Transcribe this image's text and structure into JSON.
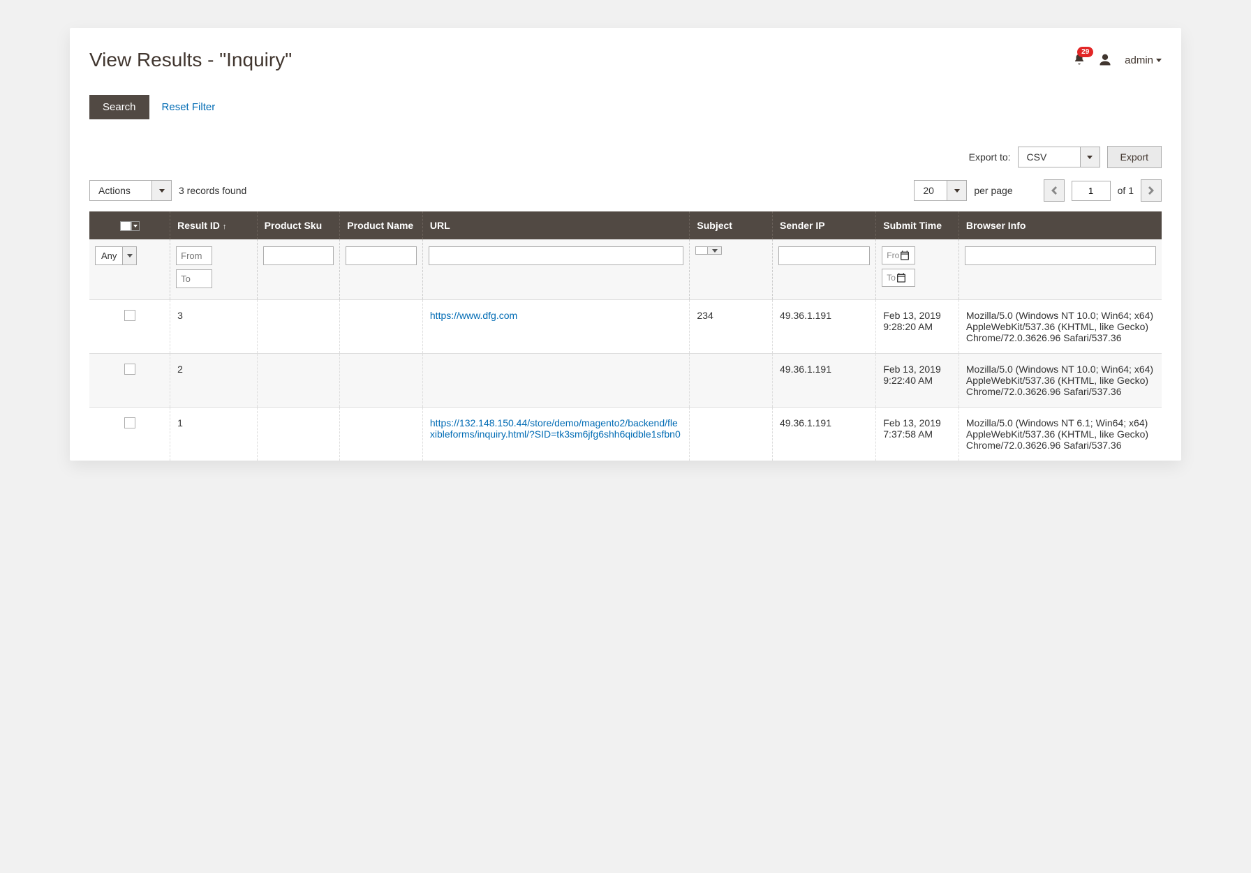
{
  "header": {
    "title": "View Results - \"Inquiry\"",
    "notification_count": "29",
    "admin_label": "admin"
  },
  "toolbar": {
    "search_label": "Search",
    "reset_filter_label": "Reset Filter"
  },
  "export": {
    "label": "Export to:",
    "format": "CSV",
    "button": "Export"
  },
  "actions": {
    "label": "Actions",
    "records_found": "3 records found"
  },
  "pager": {
    "page_size": "20",
    "per_page_label": "per page",
    "current": "1",
    "of_label": "of 1"
  },
  "columns": {
    "result_id": "Result ID",
    "product_sku": "Product Sku",
    "product_name": "Product Name",
    "url": "URL",
    "subject": "Subject",
    "sender_ip": "Sender IP",
    "submit_time": "Submit Time",
    "browser_info": "Browser Info"
  },
  "filters": {
    "any": "Any",
    "from_ph": "From",
    "to_ph": "To",
    "date_from_ph": "Fro",
    "date_to_ph": "To"
  },
  "rows": [
    {
      "id": "3",
      "sku": "",
      "pname": "",
      "url": "https://www.dfg.com",
      "subject": "234",
      "ip": "49.36.1.191",
      "time": "Feb 13, 2019 9:28:20 AM",
      "browser": "Mozilla/5.0 (Windows NT 10.0; Win64; x64) AppleWebKit/537.36 (KHTML, like Gecko) Chrome/72.0.3626.96 Safari/537.36"
    },
    {
      "id": "2",
      "sku": "",
      "pname": "",
      "url": "",
      "subject": "",
      "ip": "49.36.1.191",
      "time": "Feb 13, 2019 9:22:40 AM",
      "browser": "Mozilla/5.0 (Windows NT 10.0; Win64; x64) AppleWebKit/537.36 (KHTML, like Gecko) Chrome/72.0.3626.96 Safari/537.36"
    },
    {
      "id": "1",
      "sku": "",
      "pname": "",
      "url": "https://132.148.150.44/store/demo/magento2/backend/flexibleforms/inquiry.html/?SID=tk3sm6jfg6shh6qidble1sfbn0",
      "subject": "",
      "ip": "49.36.1.191",
      "time": "Feb 13, 2019 7:37:58 AM",
      "browser": "Mozilla/5.0 (Windows NT 6.1; Win64; x64) AppleWebKit/537.36 (KHTML, like Gecko) Chrome/72.0.3626.96 Safari/537.36"
    }
  ]
}
